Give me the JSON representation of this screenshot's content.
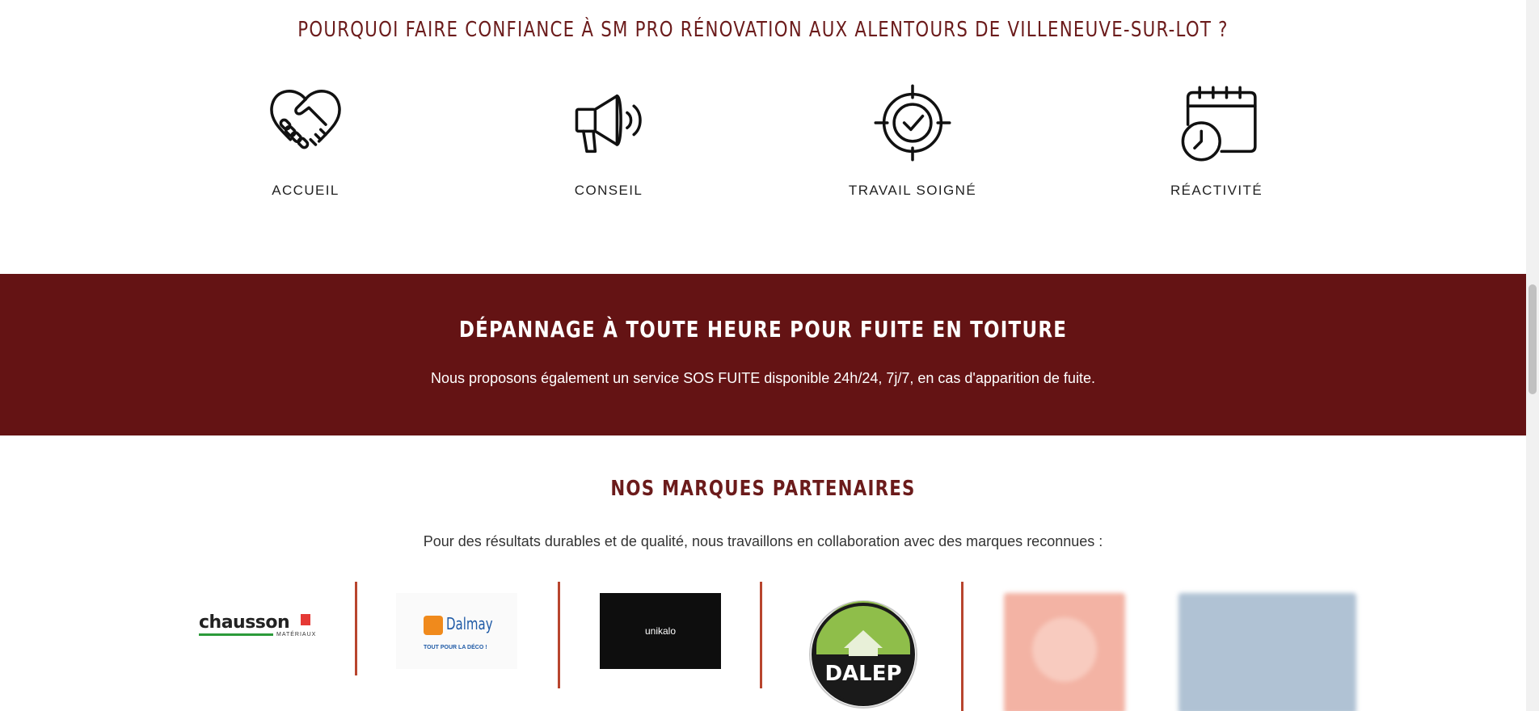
{
  "why_section": {
    "title": "POURQUOI FAIRE CONFIANCE À SM PRO RÉNOVATION AUX ALENTOURS DE VILLENEUVE-SUR-LOT ?",
    "features": [
      {
        "label": "ACCUEIL",
        "icon": "handshake-heart-icon"
      },
      {
        "label": "CONSEIL",
        "icon": "megaphone-icon"
      },
      {
        "label": "TRAVAIL SOIGNÉ",
        "icon": "target-check-icon"
      },
      {
        "label": "RÉACTIVITÉ",
        "icon": "calendar-clock-icon"
      }
    ]
  },
  "emergency_band": {
    "title": "DÉPANNAGE À TOUTE HEURE POUR FUITE EN TOITURE",
    "text": "Nous proposons également un service SOS FUITE disponible 24h/24, 7j/7, en cas d'apparition de fuite.",
    "background_color": "#641314"
  },
  "partners_section": {
    "title": "NOS MARQUES PARTENAIRES",
    "text": "Pour des résultats durables et de qualité, nous travaillons en collaboration avec des marques reconnues :",
    "logos": [
      {
        "name": "chausson",
        "sub": "MATÉRIAUX"
      },
      {
        "name": "Dalmay",
        "tag": "TOUT POUR LA DÉCO !"
      },
      {
        "name": "unikalo"
      },
      {
        "name": "DALEP"
      },
      {
        "name": ""
      },
      {
        "name": ""
      }
    ]
  },
  "colors": {
    "accent": "#6b1b1b",
    "divider": "#b8452e"
  }
}
